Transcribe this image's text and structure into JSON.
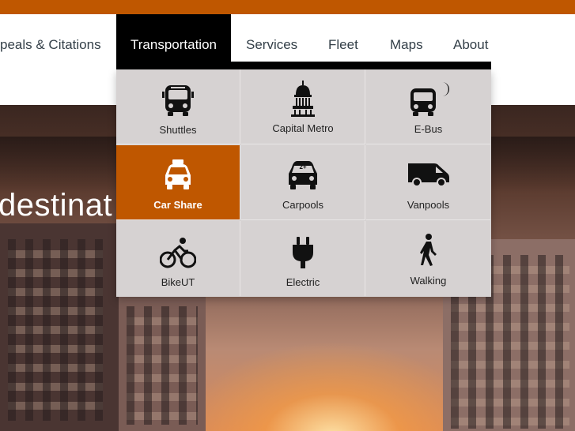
{
  "nav": {
    "items": [
      {
        "label": "peals & Citations"
      },
      {
        "label": "Transportation"
      },
      {
        "label": "Services"
      },
      {
        "label": "Fleet"
      },
      {
        "label": "Maps"
      },
      {
        "label": "About"
      }
    ]
  },
  "hero": {
    "headline": "destinat"
  },
  "menu": {
    "tiles": [
      {
        "label": "Shuttles",
        "icon": "bus-icon"
      },
      {
        "label": "Capital Metro",
        "icon": "capitol-icon"
      },
      {
        "label": "E-Bus",
        "icon": "night-bus-icon"
      },
      {
        "label": "Car Share",
        "icon": "taxi-icon"
      },
      {
        "label": "Carpools",
        "icon": "carpool-icon",
        "badge": "2+"
      },
      {
        "label": "Vanpools",
        "icon": "van-icon"
      },
      {
        "label": "BikeUT",
        "icon": "bicycle-icon"
      },
      {
        "label": "Electric",
        "icon": "plug-icon"
      },
      {
        "label": "Walking",
        "icon": "walking-icon"
      }
    ]
  },
  "colors": {
    "accent": "#bf5700",
    "nav_text": "#333f48",
    "menu_bg": "#d6d2d2"
  }
}
